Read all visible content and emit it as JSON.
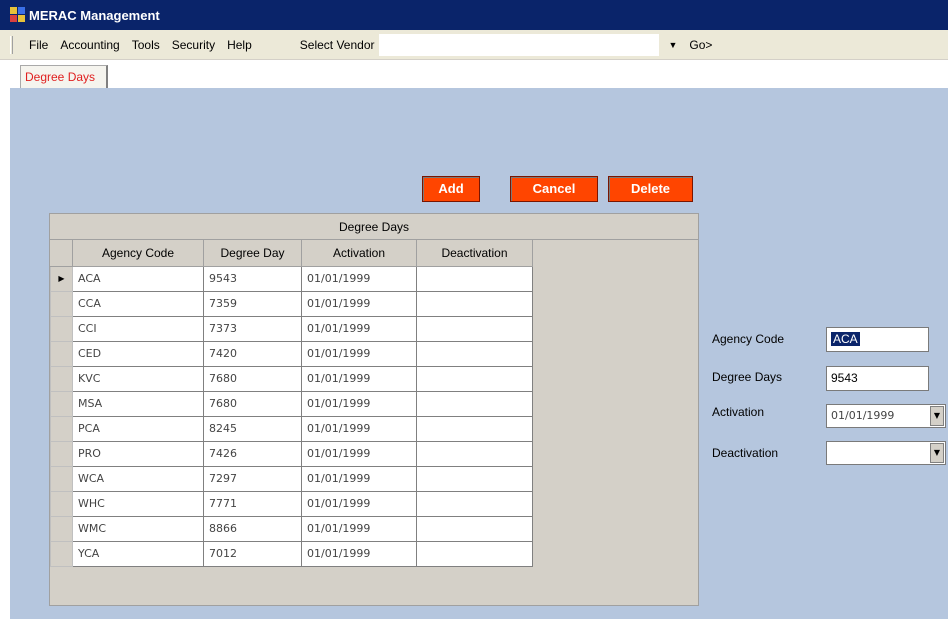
{
  "window": {
    "title": "MERAC Management"
  },
  "menu": {
    "items": [
      "File",
      "Accounting",
      "Tools",
      "Security",
      "Help"
    ],
    "vendor_label": "Select Vendor",
    "vendor_value": "",
    "go_label": "Go>"
  },
  "tabs": [
    {
      "label": "Degree Days"
    }
  ],
  "toolbar": {
    "add_label": "Add",
    "cancel_label": "Cancel",
    "delete_label": "Delete"
  },
  "grid": {
    "caption": "Degree Days",
    "columns": [
      "Agency Code",
      "Degree Day",
      "Activation",
      "Deactivation"
    ],
    "rows": [
      [
        "ACA",
        "9543",
        "01/01/1999",
        ""
      ],
      [
        "CCA",
        "7359",
        "01/01/1999",
        ""
      ],
      [
        "CCI",
        "7373",
        "01/01/1999",
        ""
      ],
      [
        "CED",
        "7420",
        "01/01/1999",
        ""
      ],
      [
        "KVC",
        "7680",
        "01/01/1999",
        ""
      ],
      [
        "MSA",
        "7680",
        "01/01/1999",
        ""
      ],
      [
        "PCA",
        "8245",
        "01/01/1999",
        ""
      ],
      [
        "PRO",
        "7426",
        "01/01/1999",
        ""
      ],
      [
        "WCA",
        "7297",
        "01/01/1999",
        ""
      ],
      [
        "WHC",
        "7771",
        "01/01/1999",
        ""
      ],
      [
        "WMC",
        "8866",
        "01/01/1999",
        ""
      ],
      [
        "YCA",
        "7012",
        "01/01/1999",
        ""
      ]
    ],
    "current_row_indicator": "▶"
  },
  "detail": {
    "agency_code_label": "Agency Code",
    "agency_code_value": "ACA",
    "degree_days_label": "Degree Days",
    "degree_days_value": "9543",
    "activation_label": "Activation",
    "activation_value": "01/01/1999",
    "deactivation_label": "Deactivation",
    "deactivation_value": ""
  },
  "colors": {
    "titlebar": "#0a246a",
    "content_bg": "#b5c6de",
    "button_bg": "#ff4500",
    "tab_text": "#e02020"
  },
  "icons": {
    "app": "app-icon",
    "dropdown": "dropdown-arrow-icon",
    "row_pointer": "row-pointer-icon"
  }
}
